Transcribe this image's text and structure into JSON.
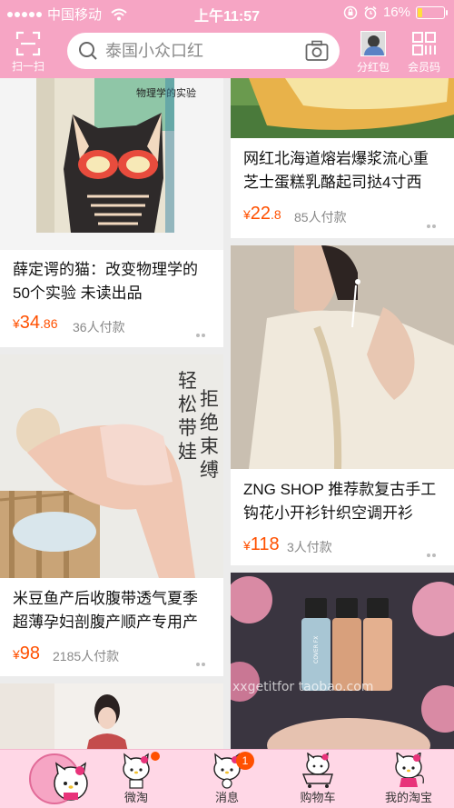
{
  "status_bar": {
    "carrier": "中国移动",
    "time": "上午11:57",
    "battery": "16%"
  },
  "header": {
    "scan_label": "扫一扫",
    "search_placeholder": "泰国小众口红",
    "red_packet_label": "分红包",
    "member_code_label": "会员码"
  },
  "feed": {
    "left": [
      {
        "title": "薛定谔的猫：改变物理学的50个实验  未读出品",
        "currency": "¥",
        "price_int": "34",
        "price_dec": ".86",
        "sold": "36人付款",
        "image_text": "物理学的实验"
      },
      {
        "title": "米豆鱼产后收腹带透气夏季超薄孕妇剖腹产顺产专用产",
        "currency": "¥",
        "price_int": "98",
        "price_dec": "",
        "sold": "2185人付款",
        "image_text_1": "轻松带娃",
        "image_text_2": "拒绝束缚"
      },
      {
        "title": "",
        "currency": "",
        "price_int": "",
        "price_dec": "",
        "sold": ""
      }
    ],
    "right": [
      {
        "title": "网红北海道熔岩爆浆流心重芝士蛋糕乳酪起司挞4寸西",
        "currency": "¥",
        "price_int": "22",
        "price_dec": ".8",
        "sold": "85人付款"
      },
      {
        "title": "ZNG SHOP 推荐款复古手工钩花小开衫针织空调开衫",
        "currency": "¥",
        "price_int": "118",
        "price_dec": "",
        "sold": "3人付款"
      },
      {
        "title": "",
        "currency": "",
        "price_int": "",
        "price_dec": "",
        "sold": "",
        "image_text": "COVER FX",
        "watermark": "xxgetitfor   taobao.com"
      }
    ]
  },
  "tabbar": {
    "items": [
      {
        "label": "",
        "icon": "hello-kitty-home-icon"
      },
      {
        "label": "微淘",
        "icon": "hello-kitty-icon"
      },
      {
        "label": "消息",
        "icon": "hello-kitty-icon",
        "badge": "1"
      },
      {
        "label": "购物车",
        "icon": "hello-kitty-cart-icon"
      },
      {
        "label": "我的淘宝",
        "icon": "hello-kitty-icon"
      }
    ]
  },
  "colors": {
    "brand_pink": "#f6a5c4",
    "price_orange": "#ff5000",
    "tab_bg": "#ffd7e6"
  }
}
